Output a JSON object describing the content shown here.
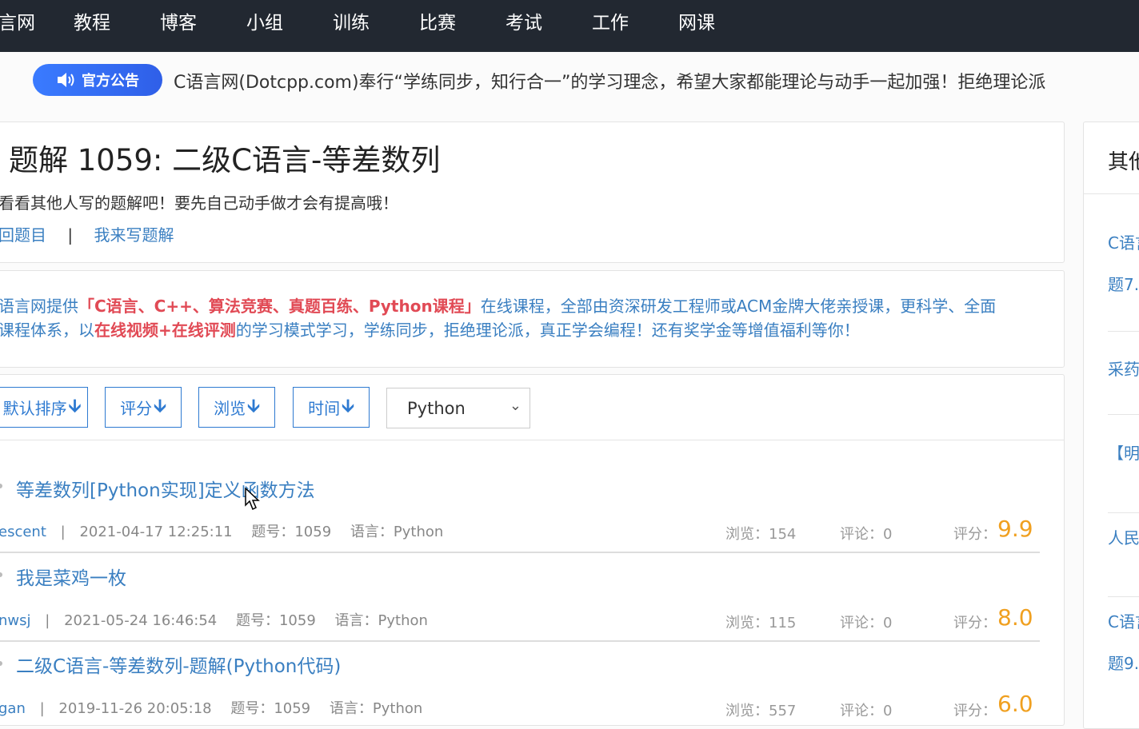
{
  "nav": {
    "brand": "言网",
    "items": [
      "教程",
      "博客",
      "小组",
      "训练",
      "比赛",
      "考试",
      "工作",
      "网课"
    ]
  },
  "notice": {
    "badge": "官方公告",
    "text": "C语言网(Dotcpp.com)奉行“学练同步，知行合一”的学习理念，希望大家都能理论与动手一起加强！拒绝理论派"
  },
  "header": {
    "title": "题解 1059: 二级C语言-等差数列",
    "subtitle": "看看其他人写的题解吧！要先自己动手做才会有提高哦！",
    "back_link": "回题目",
    "separator": "|",
    "write_link": "我来写题解"
  },
  "promo": {
    "line1_pre": "语言网提供",
    "line1_bold": "「C语言、C++、算法竞赛、真题百练、Python课程」",
    "line1_post": "在线课程，全部由资深研发工程师或ACM金牌大佬亲授课，更科学、全面",
    "line2_pre": "课程体系，以",
    "line2_bold": "在线视频+在线评测",
    "line2_post": "的学习模式学习，学练同步，拒绝理论派，真正学会编程！还有奖学金等增值福利等你！"
  },
  "sort": {
    "default_label": "默认排序",
    "score_label": "评分",
    "views_label": "浏览",
    "time_label": "时间",
    "language_selected": "Python"
  },
  "solutions": [
    {
      "title": "等差数列[Python实现]定义函数方法",
      "author": "escent",
      "date": "2021-04-17 12:25:11",
      "problem": "题号：1059",
      "language": "语言：Python",
      "views": "浏览：154",
      "comments": "评论：0",
      "score_label": "评分：",
      "score": "9.9"
    },
    {
      "title": "我是菜鸡一枚",
      "author": "nwsj",
      "date": "2021-05-24 16:46:54",
      "problem": "题号：1059",
      "language": "语言：Python",
      "views": "浏览：115",
      "comments": "评论：0",
      "score_label": "评分：",
      "score": "8.0"
    },
    {
      "title": "二级C语言-等差数列-题解(Python代码)",
      "author": "gan",
      "date": "2019-11-26 20:05:18",
      "problem": "题号：1059",
      "language": "语言：Python",
      "views": "浏览：557",
      "comments": "评论：0",
      "score_label": "评分：",
      "score": "6.0"
    }
  ],
  "sidebar": {
    "heading": "其他",
    "items": [
      "C语言",
      "题7.",
      "采药",
      "【明",
      "人民",
      "C语言",
      "题9."
    ]
  },
  "colors": {
    "nav_bg": "#222831",
    "link": "#3a7fc1",
    "accent": "#2e7ad1",
    "promo_highlight": "#e14a55",
    "score": "#f0a020"
  }
}
